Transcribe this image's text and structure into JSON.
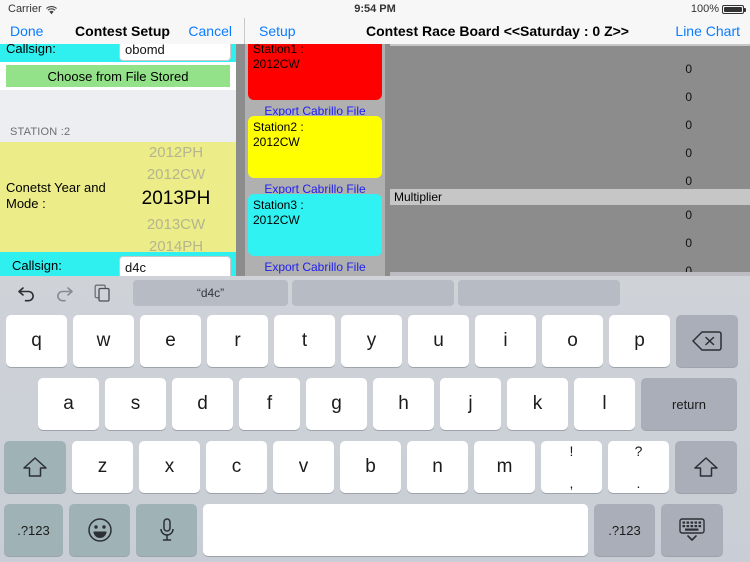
{
  "status_bar": {
    "carrier": "Carrier",
    "wifi_icon": "wifi-icon",
    "time": "9:54 PM",
    "battery_percent": "100%",
    "battery_icon": "battery-icon"
  },
  "nav_left": {
    "done_label": "Done",
    "title": "Contest Setup",
    "cancel_label": "Cancel"
  },
  "nav_right": {
    "setup_label": "Setup",
    "title": "Contest Race Board <<Saturday :  0 Z>>",
    "line_chart_label": "Line Chart"
  },
  "form": {
    "callsign_top_label": "Callsign:",
    "callsign_top_value": "obomd",
    "choose_file_label": "Choose from File Stored",
    "station_header": "STATION :2",
    "picker_label": "Conetst Year and Mode :",
    "picker_options": [
      "2012PH",
      "2012CW",
      "2013PH",
      "2013CW",
      "2014PH"
    ],
    "picker_selected": "2013PH",
    "callsign_label": "Callsign:",
    "callsign_value": "d4c"
  },
  "stations": [
    {
      "title": "Station1 :",
      "subtitle": "2012CW",
      "color": "#ff0000",
      "export_label": "Export Cabrillo File"
    },
    {
      "title": "Station2 :",
      "subtitle": "2012CW",
      "color": "#ffff00",
      "export_label": "Export Cabrillo File"
    },
    {
      "title": "Station3 :",
      "subtitle": "2012CW",
      "color": "#30f2f2",
      "export_label": "Export Cabrillo File"
    }
  ],
  "score_panel": {
    "multiplier_header": "Multiplier",
    "values_above": [
      "0",
      "0",
      "0",
      "0",
      "0"
    ],
    "values_below": [
      "0",
      "0",
      "0"
    ]
  },
  "keyboard": {
    "toolbar": {
      "undo_icon": "undo-icon",
      "redo_icon": "redo-icon",
      "paste_icon": "paste-icon",
      "suggestions": [
        "“d4c”",
        "",
        ""
      ]
    },
    "row1": [
      "q",
      "w",
      "e",
      "r",
      "t",
      "y",
      "u",
      "i",
      "o",
      "p"
    ],
    "backspace_icon": "backspace-icon",
    "row2": [
      "a",
      "s",
      "d",
      "f",
      "g",
      "h",
      "j",
      "k",
      "l"
    ],
    "return_label": "return",
    "shift_left_icon": "shift-up-icon",
    "row3": [
      "z",
      "x",
      "c",
      "v",
      "b",
      "n",
      "m"
    ],
    "punct1_top": "!",
    "punct1_bottom": ",",
    "punct2_top": "?",
    "punct2_bottom": ".",
    "shift_right_icon": "shift-up-icon",
    "numbers_left_label": ".?123",
    "emoji_icon": "emoji-icon",
    "mic_icon": "microphone-icon",
    "space_label": "",
    "numbers_right_label": ".?123",
    "hide_keyboard_icon": "hide-keyboard-icon"
  }
}
